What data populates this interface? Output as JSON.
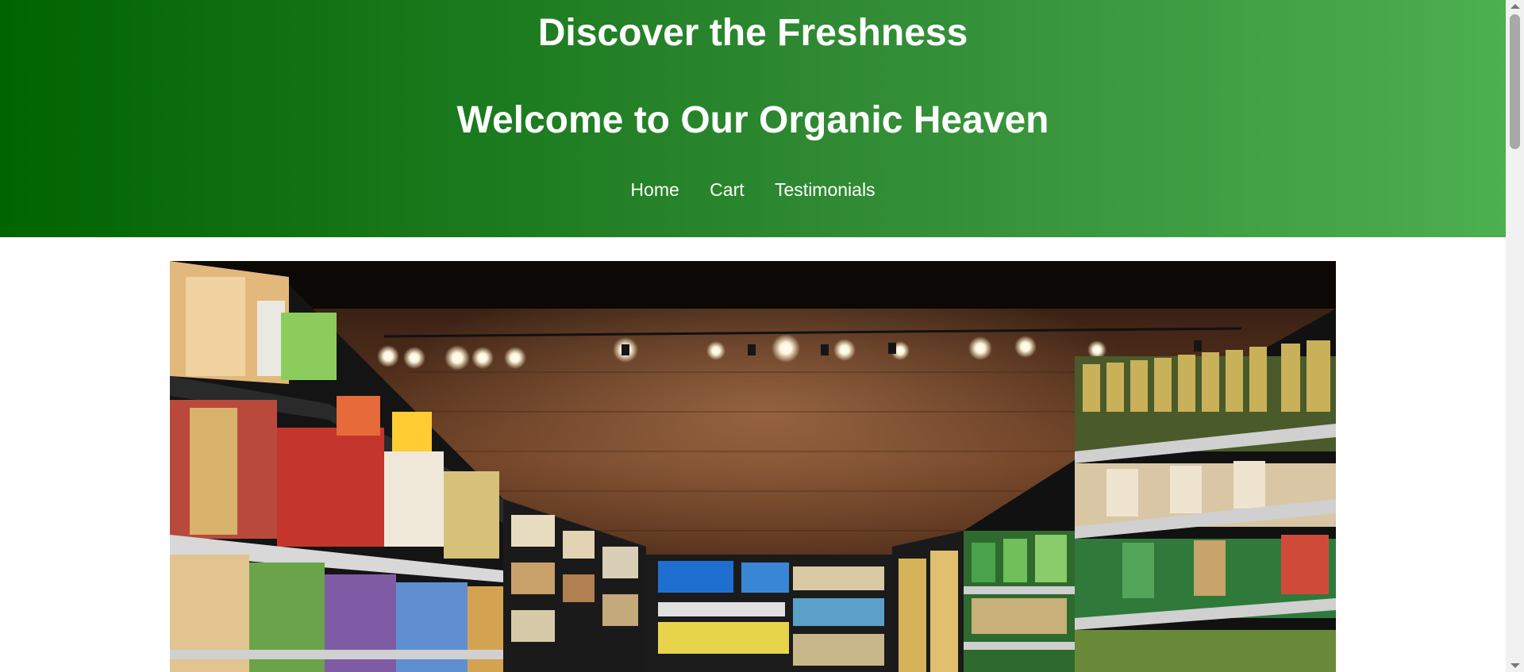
{
  "header": {
    "tagline": "Discover the Freshness",
    "title": "Welcome to Our Organic Heaven"
  },
  "nav": {
    "items": [
      {
        "label": "Home"
      },
      {
        "label": "Cart"
      },
      {
        "label": "Testimonials"
      }
    ]
  },
  "colors": {
    "header_gradient_start": "#006400",
    "header_gradient_end": "#4caf50",
    "header_text": "#ffffff"
  },
  "banner": {
    "subject": "grocery-store-aisle-photo"
  }
}
